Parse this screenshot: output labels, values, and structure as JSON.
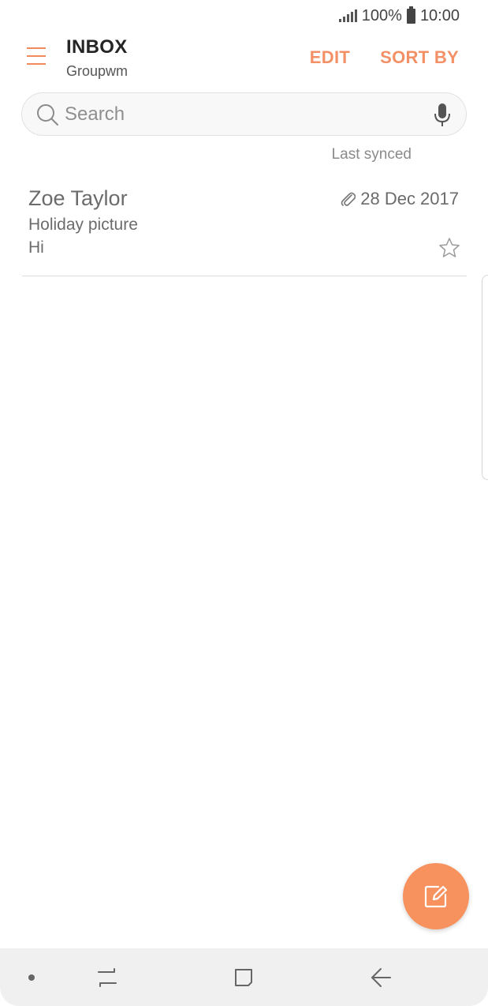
{
  "status_bar": {
    "battery": "100%",
    "time": "10:00",
    "icons": [
      "signal-icon",
      "battery-icon"
    ]
  },
  "header": {
    "title": "INBOX",
    "account": "Groupwm",
    "edit_label": "EDIT",
    "sort_label": "SORT BY",
    "menu_icon": "hamburger-menu-icon"
  },
  "search": {
    "placeholder": "Search",
    "value": "",
    "icons": [
      "search-icon",
      "mic-icon"
    ]
  },
  "sync": {
    "label": "Last synced"
  },
  "messages": [
    {
      "sender": "Zoe Taylor",
      "subject": "Holiday picture",
      "preview": "Hi",
      "date": "28 Dec 2017",
      "has_attachment": true,
      "starred": false
    }
  ],
  "fab": {
    "icon": "compose-icon"
  },
  "nav_bar": {
    "items": [
      "dot-icon",
      "recent-apps-icon",
      "home-icon",
      "back-icon"
    ]
  },
  "colors": {
    "accent": "#f39066",
    "fab": "#f7925f",
    "title": "#252525",
    "text": "#6b6b6b"
  }
}
